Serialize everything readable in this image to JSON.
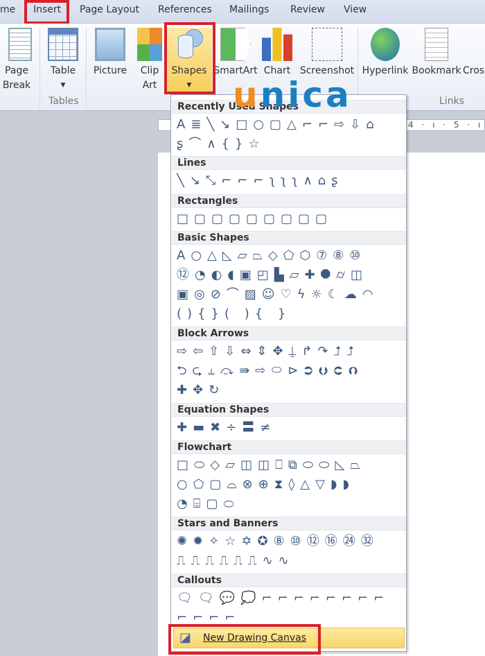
{
  "tabs": [
    {
      "label": "me"
    },
    {
      "label": "Insert"
    },
    {
      "label": "Page Layout"
    },
    {
      "label": "References"
    },
    {
      "label": "Mailings"
    },
    {
      "label": "Review"
    },
    {
      "label": "View"
    }
  ],
  "ribbon": {
    "page_break": "Page",
    "page_break2": "Break",
    "table": "Table",
    "tables_group": "Tables",
    "picture": "Picture",
    "clip": "Clip",
    "clip2": "Art",
    "shapes": "Shapes",
    "smartart": "SmartArt",
    "chart": "Chart",
    "screenshot": "Screenshot",
    "hyperlink": "Hyperlink",
    "bookmark": "Bookmark",
    "cross": "Cros",
    "links_group": "Links"
  },
  "watermark": {
    "u": "u",
    "rest": "nica",
    "orange": "#f28c1e",
    "blue": "#1b7fc1"
  },
  "ruler": {
    "text": "4 · ı · 5 · ı"
  },
  "menu": {
    "sections": [
      {
        "title": "Recently Used Shapes",
        "rows": [
          "A≣╲↘□○▢△⌐⌐⇨⇩⌂",
          "ʂ⌒∧{}☆"
        ]
      },
      {
        "title": "Lines",
        "rows": [
          "╲↘⤡⌐⌐⌐ʅʅʅ∧⌂ʂ"
        ]
      },
      {
        "title": "Rectangles",
        "rows": [
          "□▢▢▢▢▢▢▢▢"
        ]
      },
      {
        "title": "Basic Shapes",
        "rows": [
          "A○△◺▱⏢◇⬠⬡⑦⑧⑩",
          "⑫◔◐◖▣◰▙▱✚⯃⌭◫",
          "▣◎⊘⌒▨☺♡ϟ☼☾☁◠",
          "(){}( ){ }"
        ]
      },
      {
        "title": "Block Arrows",
        "rows": [
          "⇨⇦⇧⇩⇔⇕✥⍊↱↷⮥⮥",
          "⮌⮎⥿⤼⇛⇨⬭⊳⮊⮋⮈⮉",
          "✚✥↻"
        ]
      },
      {
        "title": "Equation Shapes",
        "rows": [
          "✚▬✖÷〓≠"
        ]
      },
      {
        "title": "Flowchart",
        "rows": [
          "□⬭◇▱◫◫⎕⧉⬭⬭◺⏢",
          "○⬠▢⌓⊗⊕⧗◊△▽◗◗",
          "◔⌸▢⬭"
        ]
      },
      {
        "title": "Stars and Banners",
        "rows": [
          "✺✹✧☆✡✪⑧⑩⑫⑯㉔㉜",
          "⎍⎍⎍⎍⎍⎍∿∿"
        ]
      },
      {
        "title": "Callouts",
        "rows": [
          "🗨🗨💬💭⌐⌐⌐⌐⌐⌐⌐⌐",
          "⌐⌐⌐⌐"
        ]
      }
    ],
    "new_canvas": "New Drawing Canvas"
  }
}
